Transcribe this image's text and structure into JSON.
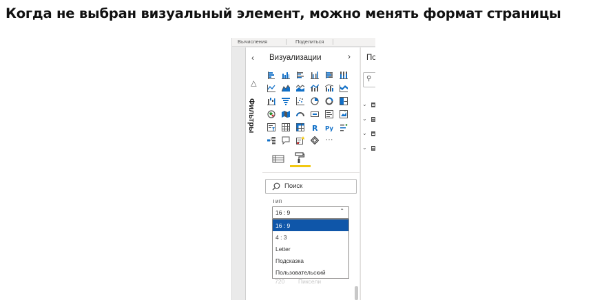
{
  "heading": "Когда не выбран визуальный элемент, можно менять формат страницы",
  "ribbon": {
    "items": [
      "Вычисления",
      "Поделиться"
    ]
  },
  "filters_pane": {
    "label": "Фильтры",
    "collapse_icon": "chevron-left-icon",
    "funnel_icon": "filter-icon"
  },
  "visualizations_pane": {
    "title": "Визуализации",
    "expand_icon": "chevron-right-icon",
    "visual_icons": [
      "stacked-bar-chart-icon",
      "stacked-column-chart-icon",
      "clustered-bar-chart-icon",
      "clustered-column-chart-icon",
      "100-stacked-bar-chart-icon",
      "100-stacked-column-chart-icon",
      "line-chart-icon",
      "area-chart-icon",
      "stacked-area-chart-icon",
      "line-and-stacked-column-icon",
      "line-and-clustered-column-icon",
      "ribbon-chart-icon",
      "waterfall-chart-icon",
      "funnel-icon",
      "scatter-chart-icon",
      "pie-chart-icon",
      "donut-chart-icon",
      "treemap-icon",
      "map-icon",
      "filled-map-icon",
      "gauge-icon",
      "card-icon",
      "multi-row-card-icon",
      "kpi-icon",
      "slicer-icon",
      "table-icon",
      "matrix-icon",
      "r-script-visual-icon",
      "python-visual-icon",
      "key-influencers-icon",
      "decomposition-tree-icon",
      "qa-icon",
      "smart-narrative-icon",
      "power-apps-icon",
      "more-visuals-icon"
    ],
    "tabs": [
      "fields-tab-icon",
      "format-paint-roller-icon"
    ],
    "active_tab": "format-paint-roller-icon",
    "accent_color": "#F2C811",
    "search": {
      "placeholder": "Поиск",
      "icon": "search-icon"
    },
    "type_label": "Тип",
    "type_select": {
      "value": "16 : 9",
      "options": [
        "16 : 9",
        "4 : 3",
        "Letter",
        "Подсказка",
        "Пользовательский"
      ],
      "selected_index": 0,
      "selected_color": "#0F56A9"
    },
    "obscured_values": [
      "720",
      "Пиксели"
    ]
  },
  "fields_pane": {
    "title_partial": "По",
    "search_icon": "search-icon",
    "rows": [
      {
        "icon": "table-icon"
      },
      {
        "icon": "table-icon"
      },
      {
        "icon": "table-icon"
      },
      {
        "icon": "table-icon"
      }
    ]
  }
}
